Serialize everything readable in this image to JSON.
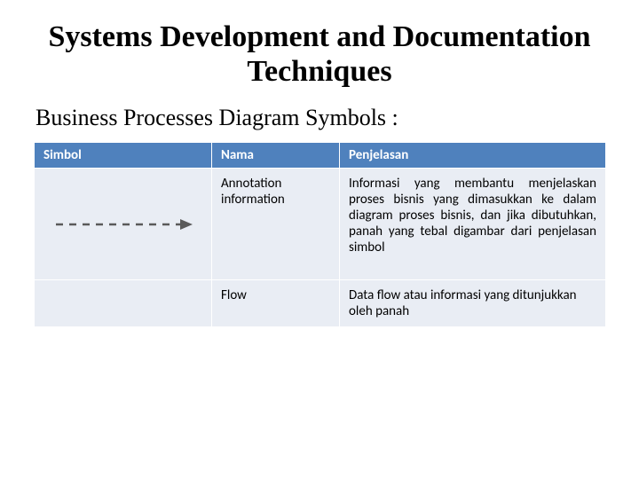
{
  "title": "Systems Development and Documentation Techniques",
  "subtitle": "Business Processes Diagram Symbols :",
  "headers": {
    "c1": "Simbol",
    "c2": "Nama",
    "c3": "Penjelasan"
  },
  "rows": [
    {
      "symbol": "dashed-arrow",
      "name": "Annotation information",
      "desc": "Informasi yang membantu menjelaskan proses bisnis  yang dimasukkan ke dalam diagram proses bisnis, dan jika dibutuhkan, panah yang tebal digambar dari penjelasan simbol"
    },
    {
      "symbol": "",
      "name": "Flow",
      "desc": "Data flow atau informasi yang ditunjukkan oleh panah"
    }
  ]
}
